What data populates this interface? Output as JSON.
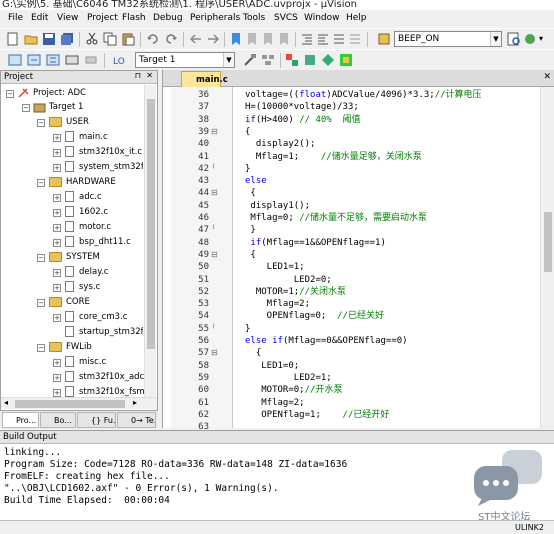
{
  "window": {
    "title": "G:\\实例\\5. 基础\\C6046 TM32系统检测\\1. 程序\\USER\\ADC.uvprojx - µVision"
  },
  "menu": [
    "File",
    "Edit",
    "View",
    "Project",
    "Flash",
    "Debug",
    "Peripherals",
    "Tools",
    "SVCS",
    "Window",
    "Help"
  ],
  "toolbar": {
    "target_combo": "BEEP_ON",
    "target_select": "Target 1"
  },
  "project": {
    "title": "Project",
    "root": "Project: ADC",
    "target": "Target 1",
    "groups": [
      {
        "name": "USER",
        "files": [
          "main.c",
          "stm32f10x_it.c",
          "system_stm32f10"
        ]
      },
      {
        "name": "HARDWARE",
        "files": [
          "adc.c",
          "1602.c",
          "motor.c",
          "bsp_dht11.c"
        ]
      },
      {
        "name": "SYSTEM",
        "files": [
          "delay.c",
          "sys.c"
        ]
      },
      {
        "name": "CORE",
        "files": [
          "core_cm3.c",
          "startup_stm32f10"
        ]
      },
      {
        "name": "FWLib",
        "files": [
          "misc.c",
          "stm32f10x_adc.c",
          "stm32f10x_fsmc."
        ]
      }
    ],
    "tabs": [
      "Pro...",
      "Bo...",
      "{} Fu...",
      "0→ Te..."
    ]
  },
  "editor": {
    "tab": "main.c",
    "lines": [
      {
        "n": "36",
        "text": "voltage=((float)ADCValue/4096)*3.3;//计算电压"
      },
      {
        "n": "37",
        "text": "H=(10000*voltage)/33;"
      },
      {
        "n": "38",
        "text": "if(H>400) // 40%  阈值"
      },
      {
        "n": "39",
        "text": "{"
      },
      {
        "n": "40",
        "text": "  display2();"
      },
      {
        "n": "41",
        "text": "  Mflag=1;    //储水量足够，关闭水泵"
      },
      {
        "n": "42",
        "text": "}"
      },
      {
        "n": "43",
        "text": "else"
      },
      {
        "n": "44",
        "text": " {"
      },
      {
        "n": "45",
        "text": " display1();"
      },
      {
        "n": "46",
        "text": " Mflag=0; //储水量不足够，需要启动水泵"
      },
      {
        "n": "47",
        "text": " }"
      },
      {
        "n": "48",
        "text": " if(Mflag==1&&OPENflag==1)"
      },
      {
        "n": "49",
        "text": " {"
      },
      {
        "n": "50",
        "text": "    LED1=1;"
      },
      {
        "n": "51",
        "text": "         LED2=0;"
      },
      {
        "n": "52",
        "text": "  MOTOR=1;//关闭水泵"
      },
      {
        "n": "53",
        "text": "    Mflag=2;"
      },
      {
        "n": "54",
        "text": "    OPENflag=0;  //已经关好"
      },
      {
        "n": "55",
        "text": "}"
      },
      {
        "n": "56",
        "text": "else if(Mflag==0&&OPENflag==0)"
      },
      {
        "n": "57",
        "text": "  {"
      },
      {
        "n": "58",
        "text": "   LED1=0;"
      },
      {
        "n": "59",
        "text": "         LED2=1;"
      },
      {
        "n": "60",
        "text": "   MOTOR=0;//开水泵"
      },
      {
        "n": "61",
        "text": "   Mflag=2;"
      },
      {
        "n": "62",
        "text": "   OPENflag=1;    //已经开好"
      },
      {
        "n": "63",
        "text": ""
      }
    ]
  },
  "build": {
    "title": "Build Output",
    "lines": [
      "linking...",
      "Program Size: Code=7128 RO-data=336 RW-data=148 ZI-data=1636",
      "FromELF: creating hex file...",
      "\"..\\OBJ\\LCD1602.axf\" - 0 Error(s), 1 Warning(s).",
      "Build Time Elapsed:  00:00:04"
    ]
  },
  "status": {
    "right": "ULINK2"
  },
  "watermark": "ST中文论坛"
}
